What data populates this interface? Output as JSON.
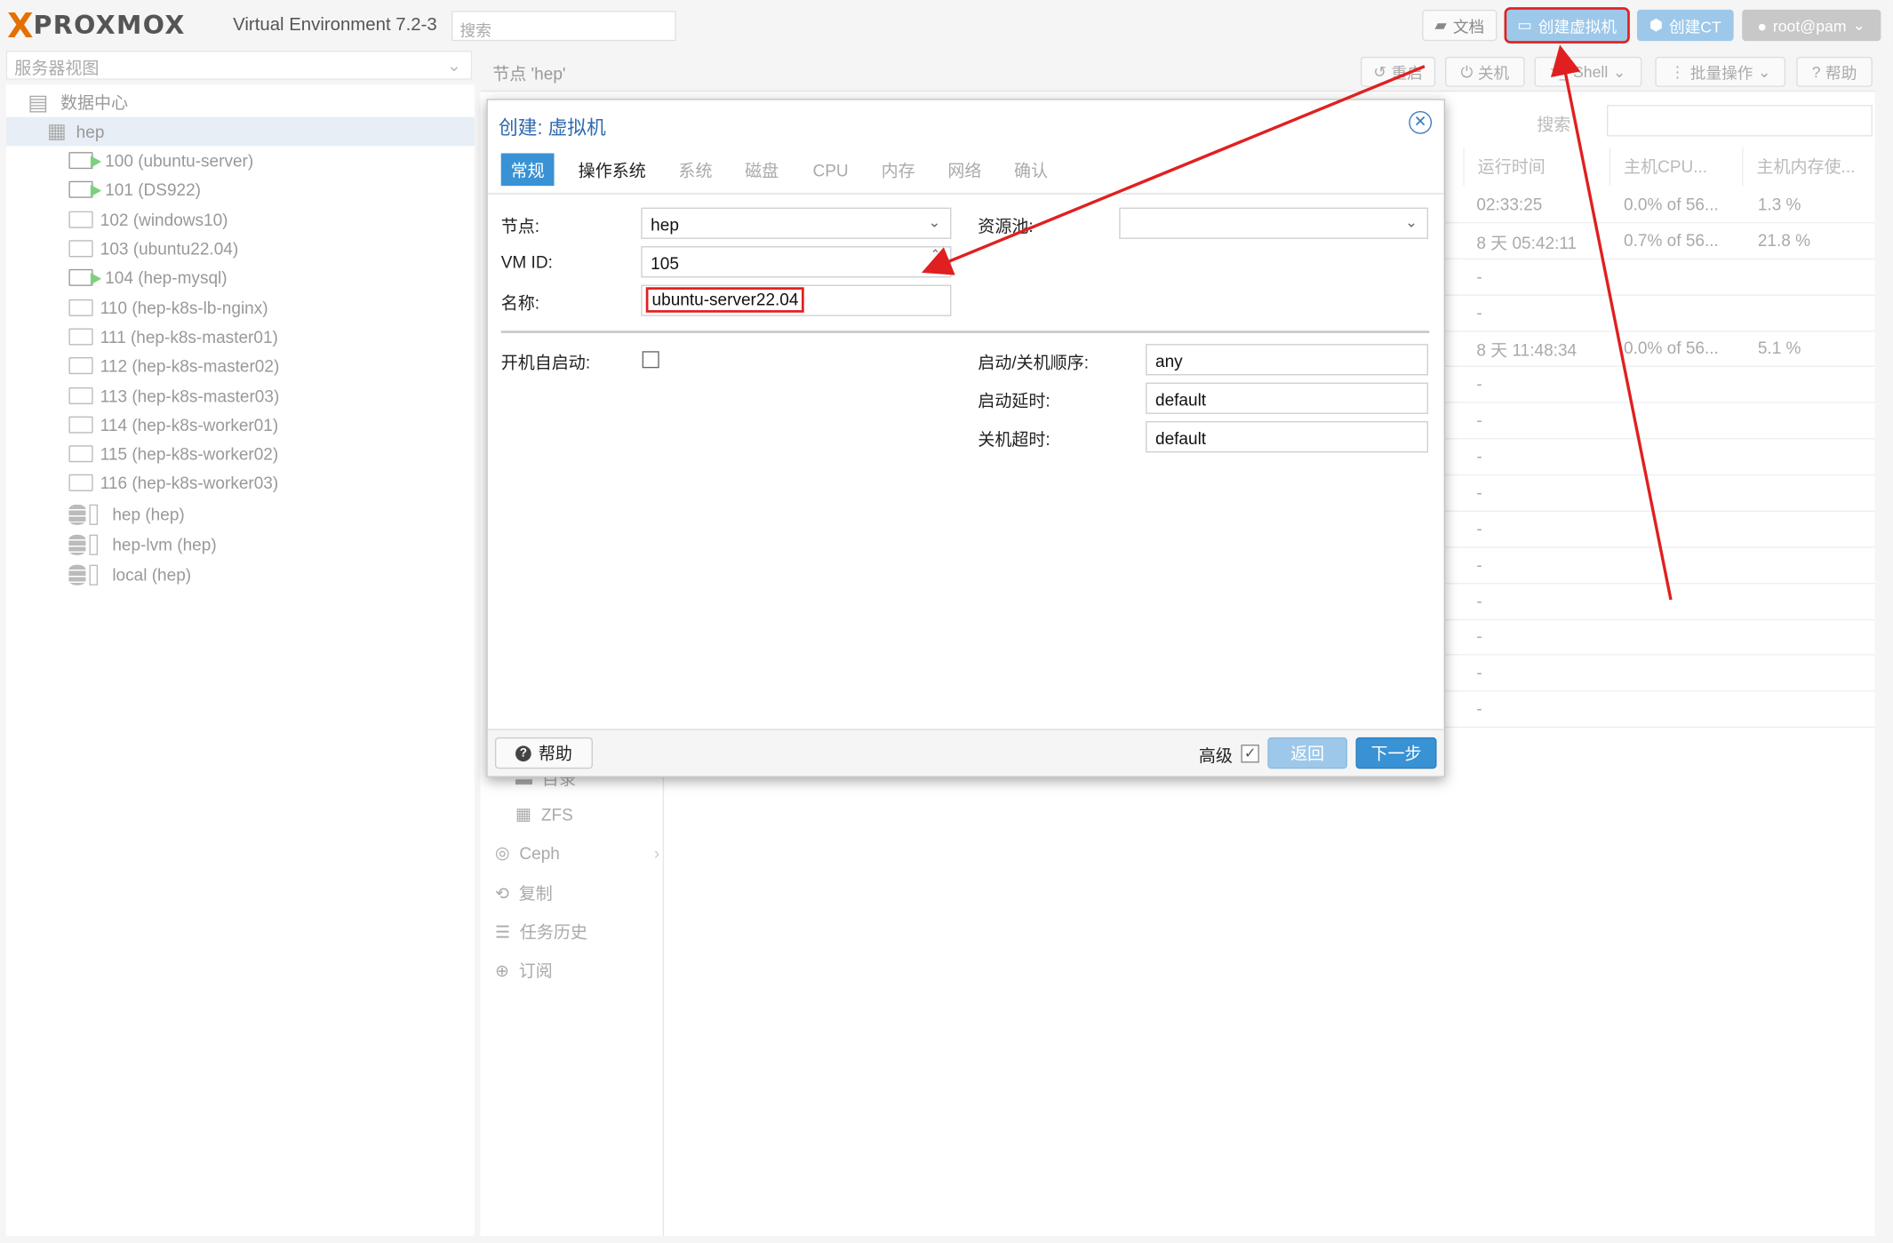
{
  "topbar": {
    "logo_x": "X",
    "logo_word": "PROXMOX",
    "version": "Virtual Environment 7.2-3",
    "search_placeholder": "搜索",
    "docs": "文档",
    "create_vm": "创建虚拟机",
    "create_ct": "创建CT",
    "user": "root@pam"
  },
  "left": {
    "view_selector": "服务器视图",
    "tree": [
      {
        "label": "数据中心",
        "type": "datacenter"
      },
      {
        "label": "hep",
        "type": "node"
      },
      {
        "label": "100 (ubuntu-server)",
        "type": "vm-running"
      },
      {
        "label": "101 (DS922)",
        "type": "vm-running"
      },
      {
        "label": "102 (windows10)",
        "type": "vm"
      },
      {
        "label": "103 (ubuntu22.04)",
        "type": "vm"
      },
      {
        "label": "104 (hep-mysql)",
        "type": "vm-running"
      },
      {
        "label": "110 (hep-k8s-lb-nginx)",
        "type": "vm"
      },
      {
        "label": "111 (hep-k8s-master01)",
        "type": "vm"
      },
      {
        "label": "112 (hep-k8s-master02)",
        "type": "vm"
      },
      {
        "label": "113 (hep-k8s-master03)",
        "type": "vm"
      },
      {
        "label": "114 (hep-k8s-worker01)",
        "type": "vm"
      },
      {
        "label": "115 (hep-k8s-worker02)",
        "type": "vm"
      },
      {
        "label": "116 (hep-k8s-worker03)",
        "type": "vm"
      },
      {
        "label": "hep (hep)",
        "type": "storage"
      },
      {
        "label": "hep-lvm (hep)",
        "type": "storage"
      },
      {
        "label": "local (hep)",
        "type": "storage"
      }
    ]
  },
  "content": {
    "crumb": "节点 'hep'",
    "toolbar": {
      "reboot": "重启",
      "shutdown": "关机",
      "shell": "Shell",
      "bulk": "批量操作",
      "help": "帮助"
    },
    "grid_search_label": "搜索",
    "columns": [
      "运行时间",
      "主机CPU...",
      "主机内存使..."
    ],
    "rows": [
      [
        "02:33:25",
        "0.0% of 56...",
        "1.3 %"
      ],
      [
        "8 天 05:42:11",
        "0.7% of 56...",
        "21.8 %"
      ],
      [
        "-",
        "",
        ""
      ],
      [
        "-",
        "",
        ""
      ],
      [
        "8 天 11:48:34",
        "0.0% of 56...",
        "5.1 %"
      ],
      [
        "-",
        "",
        ""
      ],
      [
        "-",
        "",
        ""
      ],
      [
        "-",
        "",
        ""
      ],
      [
        "-",
        "",
        ""
      ],
      [
        "-",
        "",
        ""
      ],
      [
        "-",
        "",
        ""
      ],
      [
        "-",
        "",
        ""
      ],
      [
        "-",
        "",
        ""
      ],
      [
        "-",
        "",
        ""
      ],
      [
        "-",
        "",
        ""
      ]
    ],
    "menu": [
      {
        "label": "目录",
        "icon": "folder-icon"
      },
      {
        "label": "ZFS",
        "icon": "grid-icon"
      },
      {
        "label": "Ceph",
        "icon": "ceph-icon"
      },
      {
        "label": "复制",
        "icon": "replicate-icon"
      },
      {
        "label": "任务历史",
        "icon": "list-icon"
      },
      {
        "label": "订阅",
        "icon": "lifebuoy-icon"
      }
    ]
  },
  "dialog": {
    "title": "创建: 虚拟机",
    "tabs": [
      "常规",
      "操作系统",
      "系统",
      "磁盘",
      "CPU",
      "内存",
      "网络",
      "确认"
    ],
    "fields": {
      "node_label": "节点:",
      "node_value": "hep",
      "pool_label": "资源池:",
      "pool_value": "",
      "vmid_label": "VM ID:",
      "vmid_value": "105",
      "name_label": "名称:",
      "name_value": "ubuntu-server22.04",
      "onboot_label": "开机自启动:",
      "order_label": "启动/关机顺序:",
      "order_value": "any",
      "delay_label": "启动延时:",
      "delay_value": "default",
      "timeout_label": "关机超时:",
      "timeout_value": "default"
    },
    "footer": {
      "help": "帮助",
      "advanced": "高级",
      "back": "返回",
      "next": "下一步"
    }
  },
  "colors": {
    "brand": "#e57000",
    "accent": "#3892d4",
    "annotation": "#e02020"
  }
}
